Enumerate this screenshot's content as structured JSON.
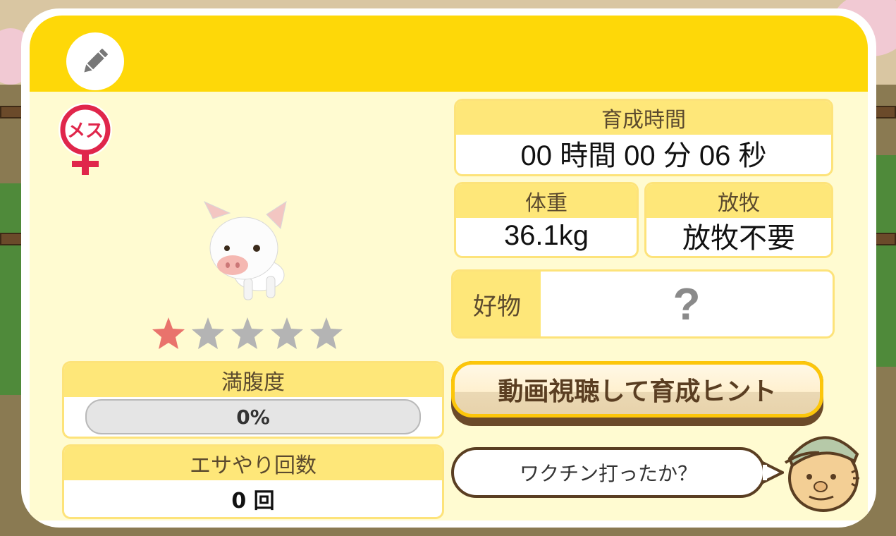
{
  "gender_badge": "メス",
  "rating": {
    "filled": 1,
    "total": 5
  },
  "satiety": {
    "label": "満腹度",
    "value": "0%",
    "fraction": 0
  },
  "feed_count": {
    "label": "エサやり回数",
    "value": "0 回"
  },
  "growth_time": {
    "label": "育成時間",
    "value": "00 時間 00 分 06 秒"
  },
  "weight": {
    "label": "体重",
    "value": "36.1kg"
  },
  "grazing": {
    "label": "放牧",
    "value": "放牧不要"
  },
  "favorite": {
    "label": "好物",
    "value": "?"
  },
  "hint_button": {
    "label": "動画視聴して育成ヒント"
  },
  "speech": {
    "text": "ワクチン打ったか？"
  },
  "colors": {
    "header_yellow": "#fed808",
    "label_yellow": "#fee779",
    "panel_cream": "#fffbd1",
    "star_filled": "#e9736c",
    "star_empty": "#b4b4b4",
    "gender_red": "#e0264b"
  },
  "icons": {
    "edit": "pencil-icon",
    "gender": "female-symbol-icon",
    "pet": "pig-icon",
    "npc": "farmer-avatar"
  }
}
